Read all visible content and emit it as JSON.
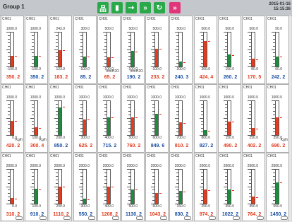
{
  "header": {
    "title": "Group 1",
    "date": "2015-01-16",
    "time": "15:15:36",
    "buttons": [
      {
        "name": "network-icon",
        "color": "#2aa94a",
        "glyph": "品"
      },
      {
        "name": "save-icon",
        "color": "#2aa94a",
        "glyph": "▮"
      },
      {
        "name": "route-icon",
        "color": "#2aa94a",
        "glyph": "⇢"
      },
      {
        "name": "forward-icon",
        "color": "#2aa94a",
        "glyph": "»"
      },
      {
        "name": "refresh-icon",
        "color": "#2aa94a",
        "glyph": "↻"
      },
      {
        "name": "pink-forward-icon",
        "color": "#e0357a",
        "glyph": "»"
      }
    ]
  },
  "colors": {
    "red": "#e33b1e",
    "green": "#1e8a3e"
  },
  "rows": [
    {
      "unit": "mmH2O",
      "cells": [
        {
          "ch": "CH01",
          "top": "1000.0",
          "bot": "-100.0",
          "val": "350. 2",
          "color": "red",
          "fill": 0.32,
          "unit_shown": false
        },
        {
          "ch": "CH01",
          "top": "1000.0",
          "bot": "-100.0",
          "val": "350. 2",
          "color": "green",
          "fill": 0.32,
          "unit_shown": false
        },
        {
          "ch": "CH01",
          "top": "243.0",
          "bot": "123.0",
          "val": "183. 2",
          "color": "red",
          "fill": 0.48,
          "unit_shown": false
        },
        {
          "ch": "CH01",
          "top": "300.0",
          "bot": "-100.0",
          "val": "85. 2",
          "color": "green",
          "fill": 0.3,
          "unit_shown": false
        },
        {
          "ch": "CH01",
          "top": "500.0",
          "bot": "-100.0",
          "val": "65. 2",
          "color": "red",
          "fill": 0.28,
          "unit_shown": true
        },
        {
          "ch": "CH01",
          "top": "500.0",
          "bot": "-100.0",
          "val": "190. 2",
          "color": "green",
          "fill": 0.45,
          "unit_shown": true
        },
        {
          "ch": "CH01",
          "top": "500.0",
          "bot": "-100.0",
          "val": "233. 2",
          "color": "red",
          "fill": 0.52,
          "unit_shown": false
        },
        {
          "ch": "CH01",
          "top": "500.0",
          "bot": "200.0",
          "val": "240. 3",
          "color": "green",
          "fill": 0.15,
          "unit_shown": false
        },
        {
          "ch": "CH01",
          "top": "500.0",
          "bot": "200.0",
          "val": "424. 4",
          "color": "red",
          "fill": 0.75,
          "unit_shown": false
        },
        {
          "ch": "CH01",
          "top": "500.0",
          "bot": "150.0",
          "val": "260. 2",
          "color": "green",
          "fill": 0.35,
          "unit_shown": false
        },
        {
          "ch": "CH01",
          "top": "500.0",
          "bot": "80.0",
          "val": "170. 5",
          "color": "red",
          "fill": 0.22,
          "unit_shown": false
        },
        {
          "ch": "CH01",
          "top": "50.0",
          "bot": "60.0",
          "val": "242. 2",
          "color": "green",
          "fill": 0.3,
          "unit_shown": false
        }
      ]
    },
    {
      "unit": "Kg/h",
      "cells": [
        {
          "ch": "CH01",
          "top": "1000.0",
          "bot": "0.0",
          "val": "420. 2",
          "color": "red",
          "fill": 0.42,
          "unit_shown": true
        },
        {
          "ch": "CH01",
          "top": "1000.0",
          "bot": "100.0",
          "val": "300. 4",
          "color": "red",
          "fill": 0.22,
          "unit_shown": true
        },
        {
          "ch": "CH01",
          "top": "1000.0",
          "bot": "200.0",
          "val": "850. 2",
          "color": "green",
          "fill": 0.82,
          "unit_shown": false
        },
        {
          "ch": "CH01",
          "top": "1000.0",
          "bot": "300.0",
          "val": "625. 2",
          "color": "red",
          "fill": 0.46,
          "unit_shown": false
        },
        {
          "ch": "CH01",
          "top": "1000.0",
          "bot": "400.0",
          "val": "715. 2",
          "color": "green",
          "fill": 0.52,
          "unit_shown": false
        },
        {
          "ch": "CH01",
          "top": "1000.0",
          "bot": "500.0",
          "val": "760. 2",
          "color": "red",
          "fill": 0.52,
          "unit_shown": false
        },
        {
          "ch": "CH01",
          "top": "1000.0",
          "bot": "600.0",
          "val": "849. 6",
          "color": "green",
          "fill": 0.62,
          "unit_shown": false
        },
        {
          "ch": "CH01",
          "top": "1000.0",
          "bot": "700.0",
          "val": "810. 2",
          "color": "red",
          "fill": 0.37,
          "unit_shown": false
        },
        {
          "ch": "CH01",
          "top": "1000.0",
          "bot": "800.0",
          "val": "827. 2",
          "color": "green",
          "fill": 0.14,
          "unit_shown": false
        },
        {
          "ch": "CH01",
          "top": "1000.0",
          "bot": "150.0",
          "val": "490. 2",
          "color": "red",
          "fill": 0.4,
          "unit_shown": false
        },
        {
          "ch": "CH01",
          "top": "1000.0",
          "bot": "250.0",
          "val": "402. 2",
          "color": "red",
          "fill": 0.2,
          "unit_shown": false
        },
        {
          "ch": "CH01",
          "top": "1000.0",
          "bot": "350.0",
          "val": "690. 2",
          "color": "red",
          "fill": 0.52,
          "unit_shown": true
        }
      ]
    },
    {
      "unit": "",
      "cells": [
        {
          "ch": "CH01",
          "top": "2000.0",
          "bot": "0.0",
          "val": "310. 2",
          "color": "red",
          "fill": 0.16,
          "unit_shown": false
        },
        {
          "ch": "CH01",
          "top": "2000.0",
          "bot": "100.0",
          "val": "910. 2",
          "color": "green",
          "fill": 0.43,
          "unit_shown": false
        },
        {
          "ch": "CH01",
          "top": "2000.0",
          "bot": "200.0",
          "val": "1110. 2",
          "color": "red",
          "fill": 0.5,
          "unit_shown": false
        },
        {
          "ch": "CH01",
          "top": "2000.0",
          "bot": "300.0",
          "val": "550. 2",
          "color": "green",
          "fill": 0.15,
          "unit_shown": false
        },
        {
          "ch": "CH01",
          "top": "2000.0",
          "bot": "400.0",
          "val": "1208. 2",
          "color": "red",
          "fill": 0.5,
          "unit_shown": false
        },
        {
          "ch": "CH01",
          "top": "2000.0",
          "bot": "500.0",
          "val": "1130. 2",
          "color": "green",
          "fill": 0.42,
          "unit_shown": false
        },
        {
          "ch": "CH01",
          "top": "2000.0",
          "bot": "600.0",
          "val": "1043. 2",
          "color": "red",
          "fill": 0.32,
          "unit_shown": false
        },
        {
          "ch": "CH01",
          "top": "2000.0",
          "bot": "150.0",
          "val": "830. 2",
          "color": "green",
          "fill": 0.37,
          "unit_shown": false
        },
        {
          "ch": "CH01",
          "top": "2000.0",
          "bot": "250.0",
          "val": "974. 2",
          "color": "red",
          "fill": 0.41,
          "unit_shown": false
        },
        {
          "ch": "CH01",
          "top": "2000.0",
          "bot": "350.0",
          "val": "1022. 2",
          "color": "green",
          "fill": 0.41,
          "unit_shown": false
        },
        {
          "ch": "CH01",
          "top": "2000.0",
          "bot": "450.0",
          "val": "764. 2",
          "color": "red",
          "fill": 0.2,
          "unit_shown": false
        },
        {
          "ch": "CH01",
          "top": "2000.0",
          "bot": "550.0",
          "val": "1450. 2",
          "color": "green",
          "fill": 0.62,
          "unit_shown": false
        }
      ]
    }
  ]
}
